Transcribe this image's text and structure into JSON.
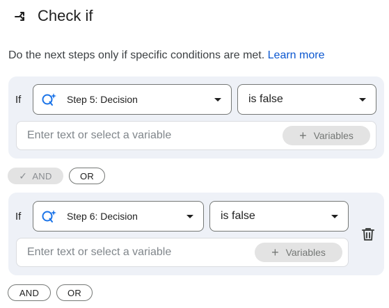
{
  "header": {
    "title": "Check if",
    "icon": "branch-icon"
  },
  "description": {
    "text": "Do the next steps only if specific conditions are met.",
    "link": "Learn more"
  },
  "conditions": [
    {
      "if_label": "If",
      "step_select": {
        "value": "Step 5: Decision",
        "icon": "gemini-step-icon"
      },
      "operator_select": {
        "value": "is false"
      },
      "input": {
        "placeholder": "Enter text or select a variable"
      },
      "variables_button": {
        "label": "Variables",
        "icon": "plus-icon"
      }
    },
    {
      "if_label": "If",
      "step_select": {
        "value": "Step 6: Decision",
        "icon": "gemini-step-icon"
      },
      "operator_select": {
        "value": "is false"
      },
      "input": {
        "placeholder": "Enter text or select a variable"
      },
      "variables_button": {
        "label": "Variables",
        "icon": "plus-icon"
      },
      "delete_icon": "trash-icon"
    }
  ],
  "connector_1": {
    "and_label": "AND",
    "or_label": "OR",
    "and_selected": true
  },
  "connector_2": {
    "and_label": "AND",
    "or_label": "OR"
  },
  "colors": {
    "accent": "#0b57d0",
    "block_bg": "#eef1f7",
    "gemini_blue": "#1a73e8"
  }
}
